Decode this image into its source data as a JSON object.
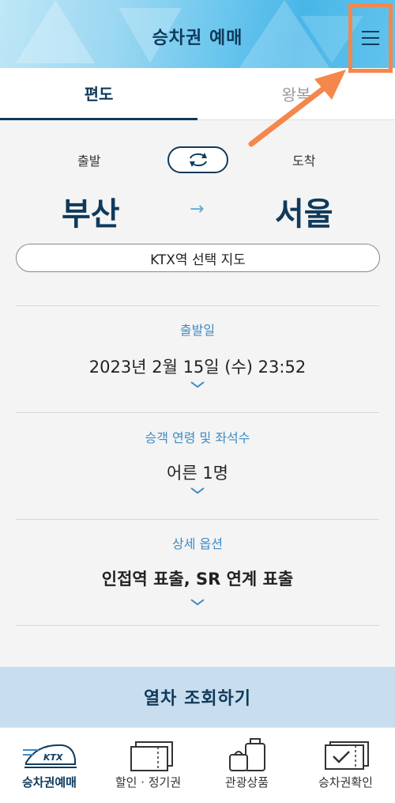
{
  "header": {
    "title": "승차권 예매"
  },
  "tabs": [
    {
      "label": "편도"
    },
    {
      "label": "왕복"
    }
  ],
  "route": {
    "departure_label": "출발",
    "arrival_label": "도착",
    "departure_station": "부산",
    "arrival_station": "서울",
    "arrow": "→"
  },
  "map_button": {
    "label": "KTX역 선택 지도"
  },
  "sections": [
    {
      "label": "출발일",
      "value": "2023년 2월 15일 (수) 23:52"
    },
    {
      "label": "승객 연령 및 좌석수",
      "value": "어른 1명"
    },
    {
      "label": "상세 옵션",
      "value": "인접역 표출, SR 연계 표출"
    }
  ],
  "search_button": {
    "label": "열차 조회하기"
  },
  "bottom_nav": [
    {
      "label": "승차권예매",
      "icon": "ktx-train-icon"
    },
    {
      "label": "할인 · 정기권",
      "icon": "discount-ticket-icon"
    },
    {
      "label": "관광상품",
      "icon": "luggage-icon"
    },
    {
      "label": "승차권확인",
      "icon": "ticket-check-icon"
    }
  ],
  "ktx_logo_text": "KTX",
  "colors": {
    "primary": "#0f3a5c",
    "accent": "#3d8bc4",
    "highlight": "#f4874a"
  }
}
